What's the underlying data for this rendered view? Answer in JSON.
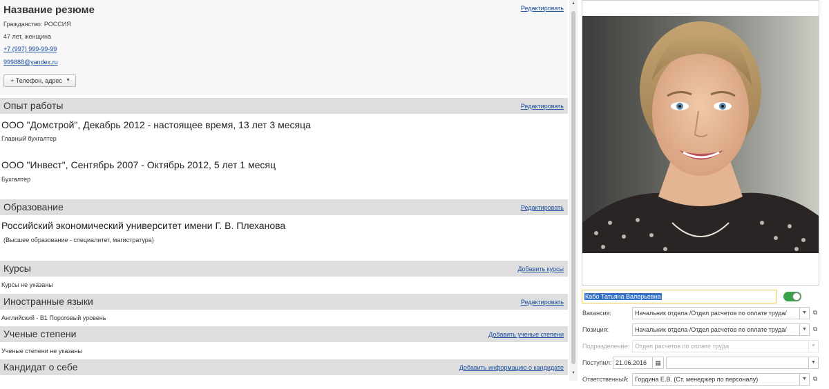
{
  "resume": {
    "title": "Название резюме",
    "edit_label": "Редактировать",
    "citizenship": "Гражданство: РОССИЯ",
    "age_gender": "47 лет, женщина",
    "phone": "+7 (997) 999-99-99",
    "email": "999888@yandex.ru",
    "phone_address_button": "+ Телефон, адрес",
    "phone_address_arrow": "▼"
  },
  "experience": {
    "title": "Опыт работы",
    "action": "Редактировать",
    "items": [
      {
        "title": "ООО \"Домстрой\", Декабрь 2012 - настоящее время, 13 лет 3 месяца",
        "position": "Главный бухгалтер"
      },
      {
        "title": "ООО \"Инвест\", Сентябрь 2007 - Октябрь 2012, 5 лет 1 месяц",
        "position": "Бухгалтер"
      }
    ]
  },
  "education": {
    "title": "Образование",
    "action": "Редактировать",
    "items": [
      {
        "title": "Российский экономический университет имени Г. В. Плеханова",
        "level": "(Высшее образование - специалитет, магистратура)"
      }
    ]
  },
  "courses": {
    "title": "Курсы",
    "action": "Добавить курсы",
    "text": "Курсы не указаны"
  },
  "languages": {
    "title": "Иностранные языки",
    "action": "Редактировать",
    "text": "Английский - В1 Пороговый уровень"
  },
  "degrees": {
    "title": "Ученые степени",
    "action": "Добавить ученые степени",
    "text": "Ученые степени не указаны"
  },
  "about": {
    "title": "Кандидат о себе",
    "action": "Добавить информацию о кандидате"
  },
  "candidate": {
    "name": "Кабо Татьяна Валерьевна",
    "active_toggle_on": true,
    "accent_color": "#3aa24a",
    "selection_color": "#3370c8",
    "fields": {
      "vacancy_label": "Вакансия:",
      "vacancy_value": "Начальник отдела /Отдел расчетов по оплате труда/",
      "position_label": "Позиция:",
      "position_value": "Начальник отдела /Отдел расчетов по оплате труда/",
      "department_label": "Подразделение:",
      "department_value": "Отдел расчетов по оплате труда",
      "received_label": "Поступил:",
      "received_value": "21.06.2016",
      "received_extra_value": "",
      "responsible_label": "Ответственный:",
      "responsible_value": "Гордина Е.В. (Ст. менеджер по персоналу)"
    }
  },
  "glyphs": {
    "dropdown": "▼",
    "open": "⧉",
    "calendar": "▦",
    "scroll_up": "▲",
    "scroll_down": "▼"
  }
}
